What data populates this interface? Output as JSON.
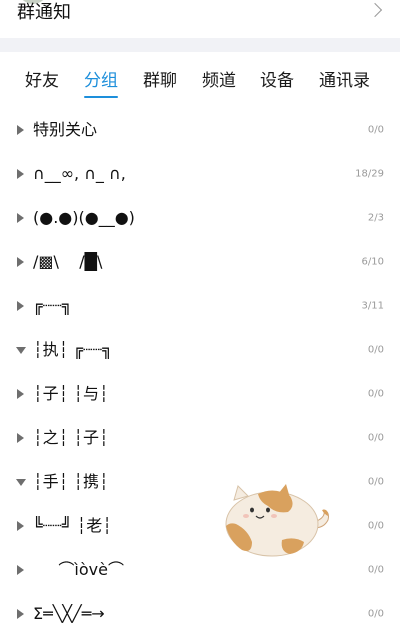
{
  "header": {
    "title": "群通知"
  },
  "tabs": [
    {
      "label": "好友"
    },
    {
      "label": "分组",
      "active": true
    },
    {
      "label": "群聊"
    },
    {
      "label": "频道"
    },
    {
      "label": "设备"
    },
    {
      "label": "通讯录"
    }
  ],
  "groups": [
    {
      "name": "特别关心",
      "count": "0/0",
      "expanded": false
    },
    {
      "name": "∩__∞, ∩_ ∩,",
      "count": "18/29",
      "expanded": false
    },
    {
      "name": "(●.●)(●__●)",
      "count": "2/3",
      "expanded": false
    },
    {
      "name": "/▩\\    /█\\",
      "count": "6/10",
      "expanded": false
    },
    {
      "name": "╔┈┈╗",
      "count": "3/11",
      "expanded": false
    },
    {
      "name": "┆执┆ ╔┈┈╗",
      "count": "0/0",
      "expanded": true
    },
    {
      "name": "┆子┆ ┆与┆",
      "count": "0/0",
      "expanded": false
    },
    {
      "name": "┆之┆ ┆子┆",
      "count": "0/0",
      "expanded": false
    },
    {
      "name": "┆手┆ ┆携┆",
      "count": "0/0",
      "expanded": true
    },
    {
      "name": "╚┈┈╝ ┆老┆",
      "count": "0/0",
      "expanded": false
    },
    {
      "name": "     ⌒ìòvè⌒",
      "count": "0/0",
      "expanded": false
    },
    {
      "name": "Σ═╲╳╱═→",
      "count": "0/0",
      "expanded": false
    }
  ],
  "sticker": {
    "icon": "cat-sticker",
    "colors": {
      "body": "#f5ece0",
      "patch": "#d9a15e"
    }
  },
  "colors": {
    "accent": "#1d8fdb"
  }
}
